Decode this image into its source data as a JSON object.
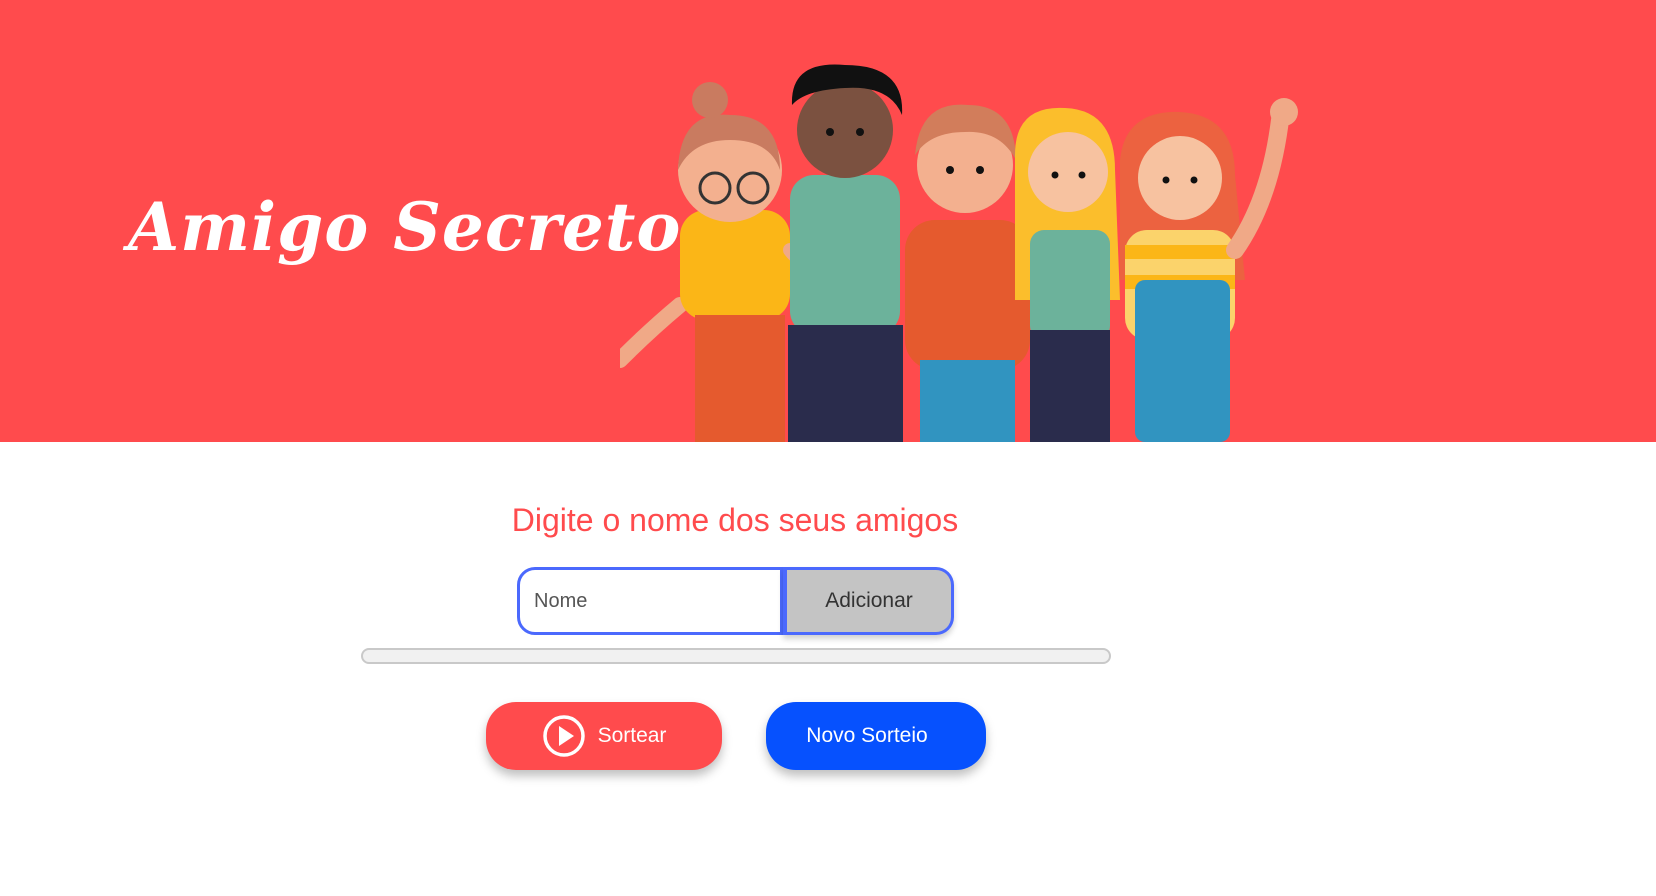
{
  "header": {
    "title": "Amigo  Secreto",
    "background_color": "#ff4b4d",
    "illustration": "group-of-friends-illustration"
  },
  "main": {
    "prompt": "Digite o nome dos seus amigos",
    "name_input": {
      "placeholder": "Nome",
      "value": ""
    },
    "add_button_label": "Adicionar",
    "draw_button": {
      "label": "Sortear",
      "icon": "play-circle-icon",
      "color": "#ff4b4d"
    },
    "new_draw_button": {
      "label": "Novo Sorteio",
      "color": "#0651fe"
    },
    "accent_color": "#4b69fd"
  }
}
